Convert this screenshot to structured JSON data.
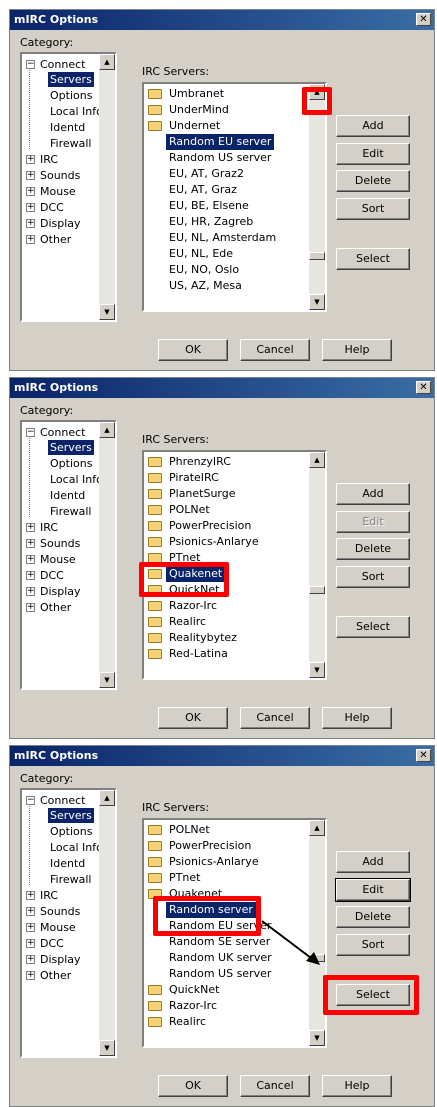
{
  "dialogs": [
    {
      "title": "mIRC Options",
      "category_label": "Category:",
      "tree": {
        "connect": "Connect",
        "children": [
          "Servers",
          "Options",
          "Local Info",
          "Identd",
          "Firewall"
        ],
        "others": [
          "IRC",
          "Sounds",
          "Mouse",
          "DCC",
          "Display",
          "Other"
        ]
      },
      "irc_label": "IRC Servers:",
      "servers": [
        {
          "label": "Umbranet",
          "type": "folder"
        },
        {
          "label": "UnderMind",
          "type": "folder"
        },
        {
          "label": "Undernet",
          "type": "folder"
        },
        {
          "label": "Random EU server",
          "type": "server",
          "selected": true
        },
        {
          "label": "Random US server",
          "type": "server"
        },
        {
          "label": "EU, AT, Graz2",
          "type": "server"
        },
        {
          "label": "EU, AT, Graz",
          "type": "server"
        },
        {
          "label": "EU, BE, Elsene",
          "type": "server"
        },
        {
          "label": "EU, HR, Zagreb",
          "type": "server"
        },
        {
          "label": "EU, NL, Amsterdam",
          "type": "server"
        },
        {
          "label": "EU, NL, Ede",
          "type": "server"
        },
        {
          "label": "EU, NO, Oslo",
          "type": "server"
        },
        {
          "label": "US, AZ, Mesa",
          "type": "server"
        }
      ],
      "buttons": {
        "add": "Add",
        "edit": "Edit",
        "delete": "Delete",
        "sort": "Sort",
        "select": "Select"
      },
      "footer": {
        "ok": "OK",
        "cancel": "Cancel",
        "help": "Help"
      }
    },
    {
      "title": "mIRC Options",
      "category_label": "Category:",
      "tree": {
        "connect": "Connect",
        "children": [
          "Servers",
          "Options",
          "Local Info",
          "Identd",
          "Firewall"
        ],
        "others": [
          "IRC",
          "Sounds",
          "Mouse",
          "DCC",
          "Display",
          "Other"
        ]
      },
      "irc_label": "IRC Servers:",
      "servers": [
        {
          "label": "PhrenzyIRC",
          "type": "folder"
        },
        {
          "label": "PirateIRC",
          "type": "folder"
        },
        {
          "label": "PlanetSurge",
          "type": "folder"
        },
        {
          "label": "POLNet",
          "type": "folder"
        },
        {
          "label": "PowerPrecision",
          "type": "folder"
        },
        {
          "label": "Psionics-Anlarye",
          "type": "folder"
        },
        {
          "label": "PTnet",
          "type": "folder"
        },
        {
          "label": "Quakenet",
          "type": "folder",
          "selected": true
        },
        {
          "label": "QuickNet",
          "type": "folder"
        },
        {
          "label": "Razor-Irc",
          "type": "folder"
        },
        {
          "label": "Realirc",
          "type": "folder"
        },
        {
          "label": "Realitybytez",
          "type": "folder"
        },
        {
          "label": "Red-Latina",
          "type": "folder"
        }
      ],
      "buttons": {
        "add": "Add",
        "edit": "Edit",
        "delete": "Delete",
        "sort": "Sort",
        "select": "Select"
      },
      "footer": {
        "ok": "OK",
        "cancel": "Cancel",
        "help": "Help"
      }
    },
    {
      "title": "mIRC Options",
      "category_label": "Category:",
      "tree": {
        "connect": "Connect",
        "children": [
          "Servers",
          "Options",
          "Local Info",
          "Identd",
          "Firewall"
        ],
        "others": [
          "IRC",
          "Sounds",
          "Mouse",
          "DCC",
          "Display",
          "Other"
        ]
      },
      "irc_label": "IRC Servers:",
      "servers": [
        {
          "label": "POLNet",
          "type": "folder"
        },
        {
          "label": "PowerPrecision",
          "type": "folder"
        },
        {
          "label": "Psionics-Anlarye",
          "type": "folder"
        },
        {
          "label": "PTnet",
          "type": "folder"
        },
        {
          "label": "Quakenet",
          "type": "folder"
        },
        {
          "label": "Random server",
          "type": "server",
          "selected": true
        },
        {
          "label": "Random EU server",
          "type": "server"
        },
        {
          "label": "Random SE server",
          "type": "server"
        },
        {
          "label": "Random UK server",
          "type": "server"
        },
        {
          "label": "Random US server",
          "type": "server"
        },
        {
          "label": "QuickNet",
          "type": "folder"
        },
        {
          "label": "Razor-Irc",
          "type": "folder"
        },
        {
          "label": "Realirc",
          "type": "folder"
        }
      ],
      "buttons": {
        "add": "Add",
        "edit": "Edit",
        "delete": "Delete",
        "sort": "Sort",
        "select": "Select"
      },
      "footer": {
        "ok": "OK",
        "cancel": "Cancel",
        "help": "Help"
      }
    }
  ],
  "colors": {
    "highlight": "#ff0000",
    "selection": "#0a246a",
    "titlebar_start": "#0a246a",
    "titlebar_end": "#3a6ea5",
    "dialog_face": "#d4d0c8"
  }
}
